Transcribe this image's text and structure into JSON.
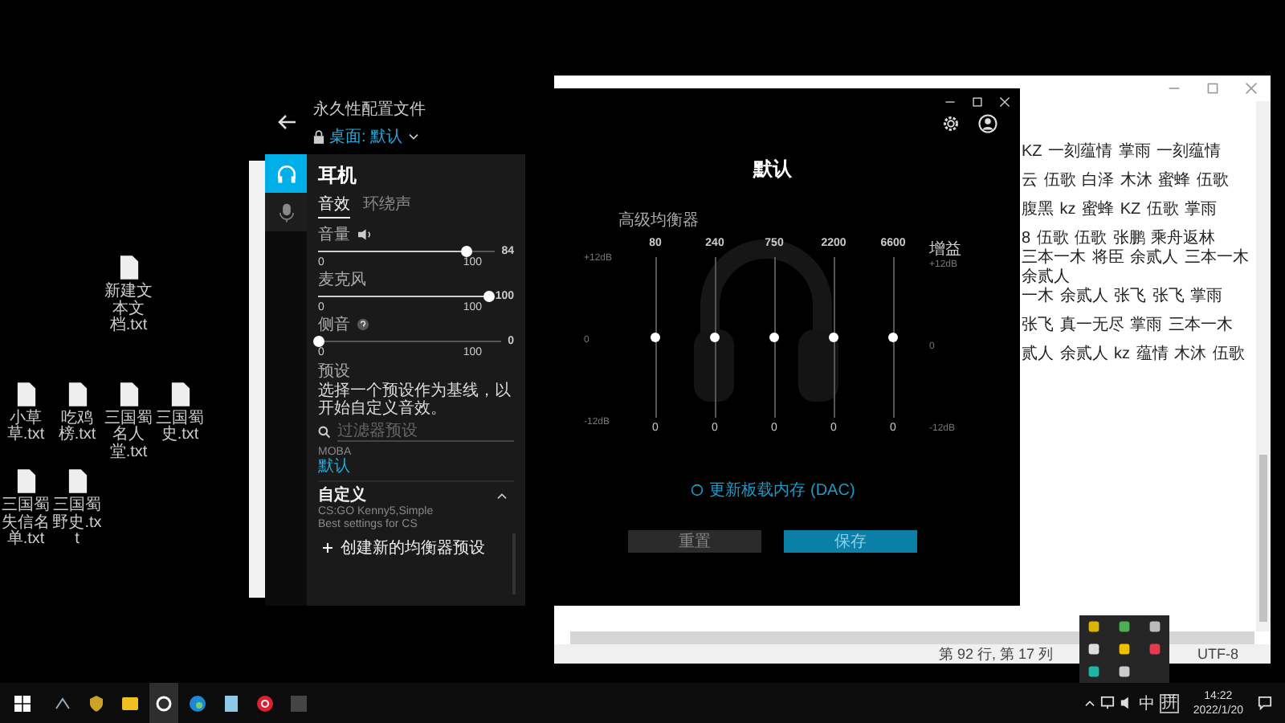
{
  "desktop_icons": [
    {
      "label": "新建文本文档.txt"
    },
    {
      "label": "小草草.txt"
    },
    {
      "label": "吃鸡榜.txt"
    },
    {
      "label": "三国蜀名人堂.txt"
    },
    {
      "label": "三国蜀史.txt"
    },
    {
      "label": "三国蜀失信名单.txt"
    },
    {
      "label": "三国蜀野史.txt"
    }
  ],
  "ghub": {
    "profile_caption": "永久性配置文件",
    "profile": "桌面: 默认",
    "nav": [
      {
        "kind": "headphones",
        "selected": true
      },
      {
        "kind": "microphone",
        "selected": false
      }
    ],
    "title": "耳机",
    "tabs": [
      {
        "label": "音效",
        "selected": true
      },
      {
        "label": "环绕声",
        "selected": false
      }
    ],
    "sliders": [
      {
        "label": "音量",
        "kind": "speaker",
        "level": 0.84,
        "reading": "84",
        "min": "0",
        "max": "100"
      },
      {
        "label": "麦克风",
        "kind": "plain",
        "level": 1,
        "reading": "100",
        "min": "0",
        "max": "100"
      },
      {
        "label": "侧音",
        "kind": "help",
        "level": 0,
        "reading": "0",
        "min": "0",
        "max": "100"
      }
    ],
    "presets": {
      "heading": "预设",
      "description": "选择一个预设作为基线，以开始自定义音效。",
      "search_placeholder": "过滤器预设",
      "groups": [
        {
          "name": "MOBA",
          "kind": "category",
          "items": [
            {
              "label": "默认",
              "selected": true
            }
          ]
        },
        {
          "name": "自定义",
          "kind": "folder",
          "expanded": true,
          "items": [
            {
              "label": "CS:GO Kenny5,Simple",
              "description": "Best settings for CS",
              "selected": false
            }
          ]
        }
      ],
      "create_button": "创建新的均衡器预设"
    },
    "eq": {
      "title": "默认",
      "heading": "高级均衡器",
      "gain_label": "增益",
      "ticks": [
        "+12dB",
        "0",
        "-12dB"
      ],
      "right_ticks": [
        "+12dB",
        "0",
        "-12dB"
      ],
      "bands": [
        {
          "freq": "80",
          "level": 0.5,
          "reading": "0"
        },
        {
          "freq": "240",
          "level": 0.5,
          "reading": "0"
        },
        {
          "freq": "750",
          "level": 0.5,
          "reading": "0"
        },
        {
          "freq": "2200",
          "level": 0.5,
          "reading": "0"
        },
        {
          "freq": "6600",
          "level": 0.5,
          "reading": "0"
        }
      ]
    },
    "dac_label": "更新板载内存 (DAC)",
    "buttons": [
      {
        "label": "重置",
        "kind": "secondary"
      },
      {
        "label": "保存",
        "kind": "primary"
      }
    ]
  },
  "notepad": {
    "paragraphs": [
      {
        "lines": [
          "KZ 一刻蕴情 掌雨 一刻蕴情"
        ]
      },
      {
        "lines": [
          "云 伍歌 白泽 木沐 蜜蜂 伍歌"
        ]
      },
      {
        "lines": [
          "腹黑 kz 蜜蜂 KZ 伍歌 掌雨"
        ]
      },
      {
        "lines": [
          "8 伍歌 伍歌 张鹏 乘舟返林",
          "三本一木 将臣 余贰人 三本一木",
          "余贰人",
          "一木 余贰人 张飞 张飞 掌雨"
        ]
      },
      {
        "lines": [
          "张飞 真一无尽 掌雨 三本一木"
        ]
      },
      {
        "lines": [
          "贰人 余贰人 kz 蕴情 木沐 伍歌"
        ]
      }
    ],
    "position": "第 92 行, 第 17 列",
    "encoding": "UTF-8"
  },
  "taskbar": {
    "apps": [
      {
        "kind": "arrows",
        "selected": false
      },
      {
        "kind": "shield",
        "selected": false
      },
      {
        "kind": "folder",
        "selected": false
      },
      {
        "kind": "ghub",
        "selected": true
      },
      {
        "kind": "edge",
        "selected": false
      },
      {
        "kind": "notepad",
        "selected": false
      },
      {
        "kind": "music",
        "selected": false
      },
      {
        "kind": "terminal",
        "selected": false
      }
    ],
    "ime": "中",
    "ime_mode": "拼",
    "time": "14:22",
    "date": "2022/1/20"
  }
}
